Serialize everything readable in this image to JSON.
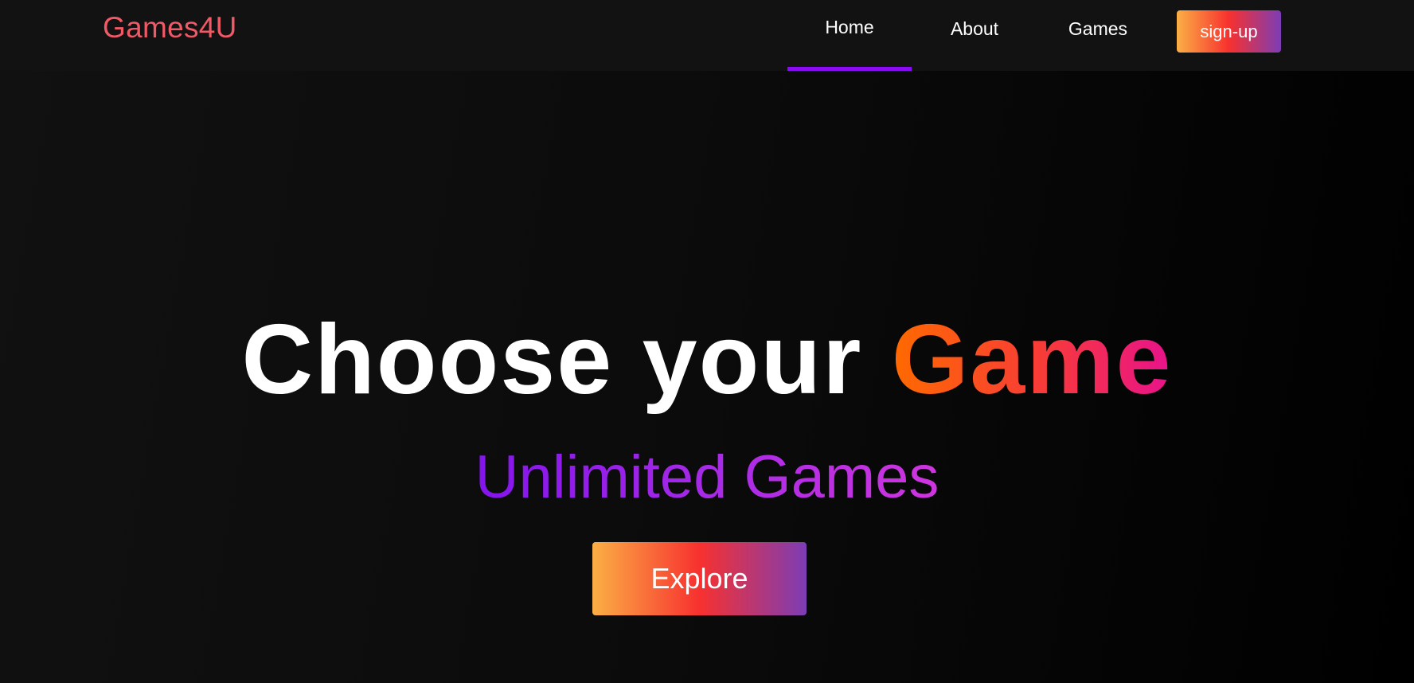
{
  "navbar": {
    "brand": "Games4U",
    "links": [
      {
        "label": "Home",
        "active": true
      },
      {
        "label": "About",
        "active": false
      },
      {
        "label": "Games",
        "active": false
      }
    ],
    "signup_label": "sign-up"
  },
  "hero": {
    "title_prefix": "Choose your",
    "title_highlight": "Game",
    "subtitle": "Unlimited Games",
    "explore_label": "Explore"
  },
  "colors": {
    "page_background": "#0c0c0c",
    "navbar_background": "#121212",
    "brand": "#f05a66",
    "active_underline": "#8a0cf2",
    "button_gradient": [
      "#fbaf45",
      "#f7312f",
      "#7c3db5"
    ],
    "title_highlight_gradient": [
      "#ff6a00",
      "#f73a3a",
      "#e8128c"
    ],
    "subtitle_gradient": [
      "#8314ec",
      "#a62ae6",
      "#cf35df"
    ]
  }
}
